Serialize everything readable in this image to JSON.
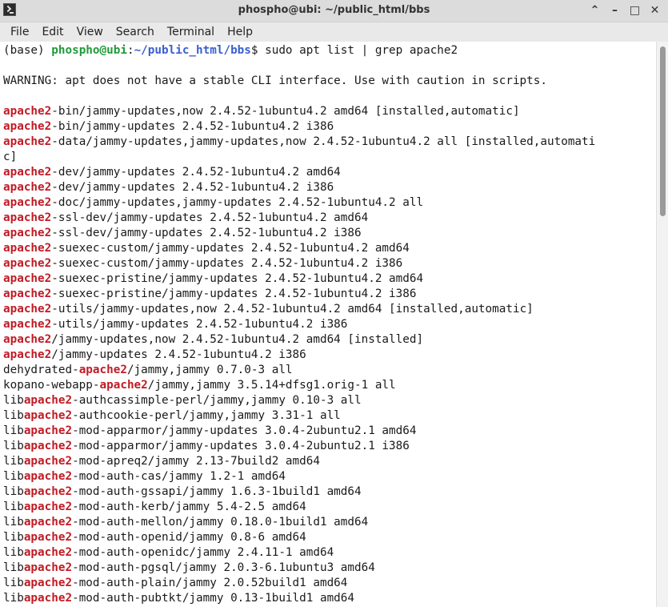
{
  "window": {
    "title": "phospho@ubi: ~/public_html/bbs",
    "controls": [
      "⌃",
      "–",
      "□",
      "✕"
    ]
  },
  "menu": [
    "File",
    "Edit",
    "View",
    "Search",
    "Terminal",
    "Help"
  ],
  "prompt": {
    "env": "(base) ",
    "user_host": "phospho@ubi",
    "sep": ":",
    "path": "~/public_html/bbs",
    "symbol": "$ ",
    "command": "sudo apt list | grep apache2"
  },
  "output_lines": [
    "",
    "WARNING: apt does not have a stable CLI interface. Use with caution in scripts.",
    "",
    "apache2-bin/jammy-updates,now 2.4.52-1ubuntu4.2 amd64 [installed,automatic]",
    "apache2-bin/jammy-updates 2.4.52-1ubuntu4.2 i386",
    "apache2-data/jammy-updates,jammy-updates,now 2.4.52-1ubuntu4.2 all [installed,automati",
    "c]",
    "apache2-dev/jammy-updates 2.4.52-1ubuntu4.2 amd64",
    "apache2-dev/jammy-updates 2.4.52-1ubuntu4.2 i386",
    "apache2-doc/jammy-updates,jammy-updates 2.4.52-1ubuntu4.2 all",
    "apache2-ssl-dev/jammy-updates 2.4.52-1ubuntu4.2 amd64",
    "apache2-ssl-dev/jammy-updates 2.4.52-1ubuntu4.2 i386",
    "apache2-suexec-custom/jammy-updates 2.4.52-1ubuntu4.2 amd64",
    "apache2-suexec-custom/jammy-updates 2.4.52-1ubuntu4.2 i386",
    "apache2-suexec-pristine/jammy-updates 2.4.52-1ubuntu4.2 amd64",
    "apache2-suexec-pristine/jammy-updates 2.4.52-1ubuntu4.2 i386",
    "apache2-utils/jammy-updates,now 2.4.52-1ubuntu4.2 amd64 [installed,automatic]",
    "apache2-utils/jammy-updates 2.4.52-1ubuntu4.2 i386",
    "apache2/jammy-updates,now 2.4.52-1ubuntu4.2 amd64 [installed]",
    "apache2/jammy-updates 2.4.52-1ubuntu4.2 i386",
    "dehydrated-apache2/jammy,jammy 0.7.0-3 all",
    "kopano-webapp-apache2/jammy,jammy 3.5.14+dfsg1.orig-1 all",
    "libapache2-authcassimple-perl/jammy,jammy 0.10-3 all",
    "libapache2-authcookie-perl/jammy,jammy 3.31-1 all",
    "libapache2-mod-apparmor/jammy-updates 3.0.4-2ubuntu2.1 amd64",
    "libapache2-mod-apparmor/jammy-updates 3.0.4-2ubuntu2.1 i386",
    "libapache2-mod-apreq2/jammy 2.13-7build2 amd64",
    "libapache2-mod-auth-cas/jammy 1.2-1 amd64",
    "libapache2-mod-auth-gssapi/jammy 1.6.3-1build1 amd64",
    "libapache2-mod-auth-kerb/jammy 5.4-2.5 amd64",
    "libapache2-mod-auth-mellon/jammy 0.18.0-1build1 amd64",
    "libapache2-mod-auth-openid/jammy 0.8-6 amd64",
    "libapache2-mod-auth-openidc/jammy 2.4.11-1 amd64",
    "libapache2-mod-auth-pgsql/jammy 2.0.3-6.1ubuntu3 amd64",
    "libapache2-mod-auth-plain/jammy 2.0.52build1 amd64",
    "libapache2-mod-auth-pubtkt/jammy 0.13-1build1 amd64"
  ],
  "highlight_term": "apache2",
  "colors": {
    "highlight": "#c01b25",
    "prompt_user": "#1f9a3a",
    "prompt_path": "#3a5fcd"
  }
}
